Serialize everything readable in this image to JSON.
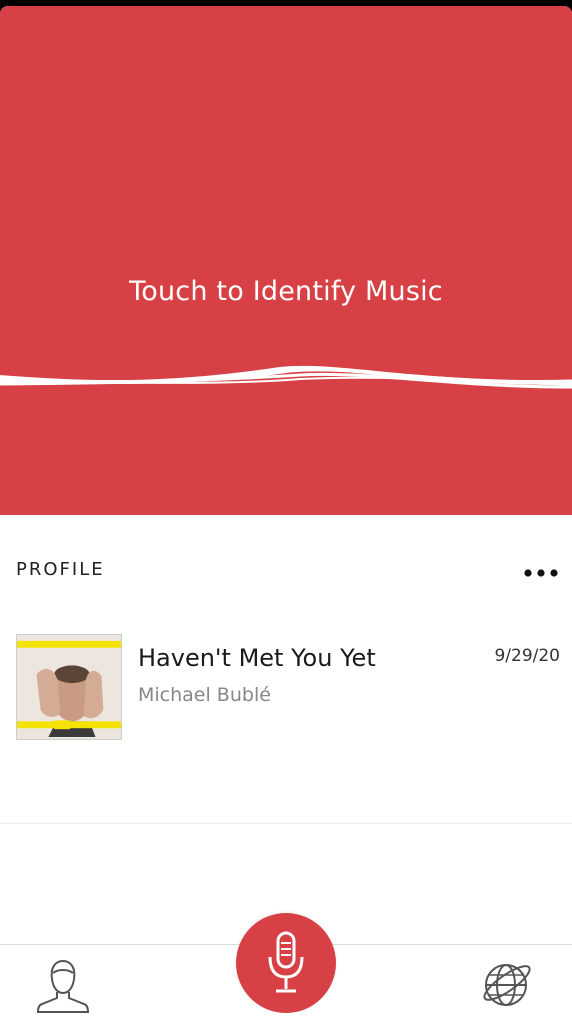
{
  "hero": {
    "prompt": "Touch to Identify Music",
    "color": "#d74044"
  },
  "profile": {
    "header": "PROFILE",
    "more_icon": "more-horizontal-icon"
  },
  "history": [
    {
      "title": "Haven't Met You Yet",
      "artist": "Michael Bublé",
      "date": "9/29/20",
      "album_art": "album-cover-crazy-love"
    }
  ],
  "tabbar": {
    "left_icon": "person-icon",
    "center_icon": "microphone-icon",
    "right_icon": "globe-icon"
  }
}
